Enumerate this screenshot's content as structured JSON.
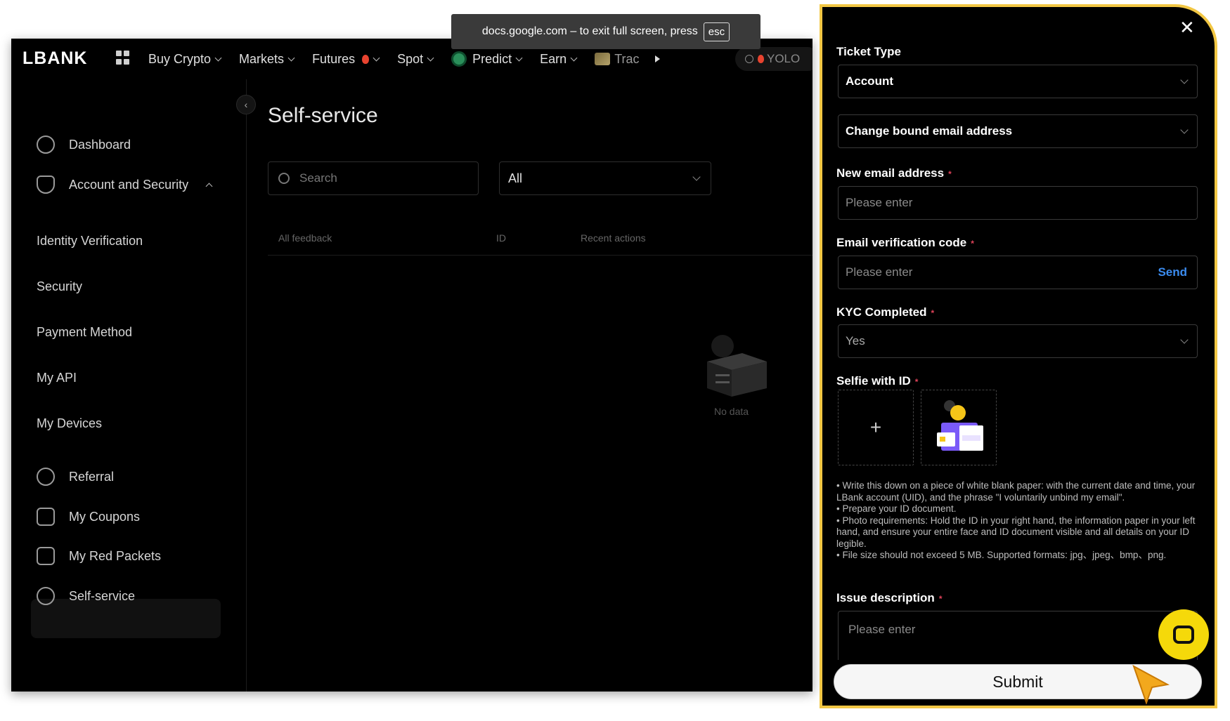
{
  "toast": {
    "text": "docs.google.com – to exit full screen, press",
    "key": "esc"
  },
  "topbar": {
    "logo": "LBANK",
    "nav": [
      {
        "label": "Buy Crypto"
      },
      {
        "label": "Markets"
      },
      {
        "label": "Futures"
      },
      {
        "label": "Spot"
      },
      {
        "label": "Predict"
      },
      {
        "label": "Earn"
      },
      {
        "label": "Trac"
      }
    ],
    "yolo": "YOLO"
  },
  "sidebar": {
    "items": [
      {
        "label": "Dashboard",
        "icon": "dashboard-icon"
      },
      {
        "label": "Account and Security",
        "icon": "shield-icon"
      },
      {
        "label": "Identity Verification"
      },
      {
        "label": "Security"
      },
      {
        "label": "Payment Method"
      },
      {
        "label": "My API"
      },
      {
        "label": "My Devices"
      },
      {
        "label": "Referral",
        "icon": "users-icon"
      },
      {
        "label": "My Coupons",
        "icon": "coupon-icon"
      },
      {
        "label": "My Red Packets",
        "icon": "red-packet-icon"
      },
      {
        "label": "Self-service",
        "icon": "headset-icon"
      }
    ]
  },
  "main": {
    "title": "Self-service",
    "search_placeholder": "Search",
    "filter_value": "All",
    "columns": [
      "All feedback",
      "ID",
      "Recent actions"
    ],
    "empty_text": "No data"
  },
  "panel": {
    "ticket_type_label": "Ticket Type",
    "ticket_type_value": "Account",
    "sub_type_value": "Change bound email address",
    "new_email_label": "New email address",
    "new_email_placeholder": "Please enter",
    "code_label": "Email verification code",
    "code_placeholder": "Please enter",
    "send_label": "Send",
    "kyc_label": "KYC Completed",
    "kyc_value": "Yes",
    "selfie_label": "Selfie with ID",
    "upload_plus": "+",
    "notes": [
      "• Write this down on a piece of white blank paper: with the current date and time, your LBank account (UID), and the phrase \"I voluntarily unbind my email\".",
      "• Prepare your ID document.",
      "• Photo requirements: Hold the ID in your right hand, the information paper in your left hand, and ensure your entire face and ID document visible and all details on your ID legible.",
      "• File size should not exceed 5 MB. Supported formats: jpg、jpeg、bmp、png."
    ],
    "issue_label": "Issue description",
    "issue_placeholder": "Please enter",
    "submit_label": "Submit"
  },
  "colors": {
    "accent_border": "#f2c744",
    "send": "#3b8cf0",
    "required": "#e0435a",
    "chat": "#f5d90a"
  }
}
